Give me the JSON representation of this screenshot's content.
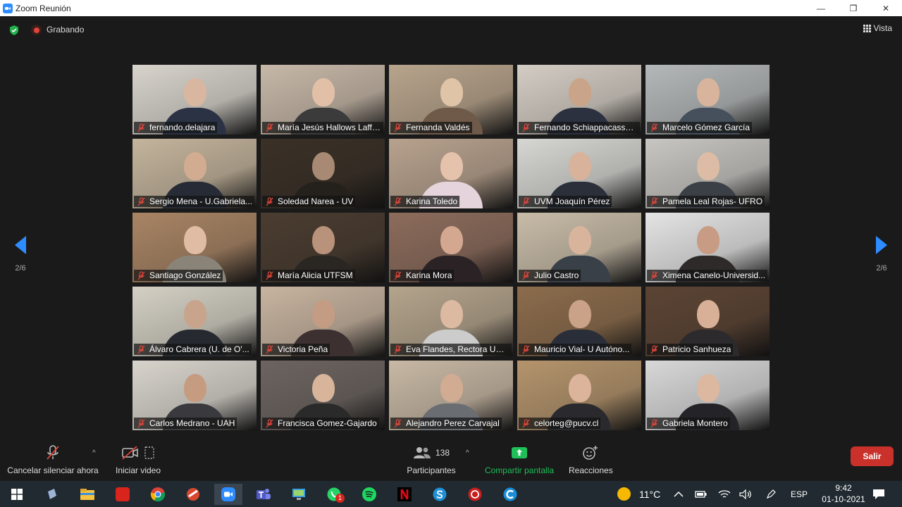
{
  "window": {
    "title": "Zoom Reunión",
    "minimize": "—",
    "maximize": "❐",
    "close": "✕"
  },
  "meeting": {
    "recording_label": "Grabando",
    "view_label": "Vista",
    "page_indicator": "2/6"
  },
  "participants": [
    {
      "name": "fernando.delajara",
      "bg": "#d8d4cc",
      "skin": "#d9b6a0",
      "shirt": "#2a3244"
    },
    {
      "name": "María Jesús Hallows Laffe...",
      "bg": "#c7b8a8",
      "skin": "#e2c0a8",
      "shirt": "#3b3b3b"
    },
    {
      "name": "Fernanda Valdés",
      "bg": "#b8a48c",
      "skin": "#e0c4a8",
      "shirt": "#6f5a4a"
    },
    {
      "name": "Fernando Schiappacasse ...",
      "bg": "#d4cdc4",
      "skin": "#c9a488",
      "shirt": "#2c3140"
    },
    {
      "name": "Marcelo Gómez García",
      "bg": "#b4b8b8",
      "skin": "#d8b49c",
      "shirt": "#46505c"
    },
    {
      "name": "Sergio Mena - U.Gabriela...",
      "bg": "#c4b49c",
      "skin": "#d2ac90",
      "shirt": "#262b36"
    },
    {
      "name": "Soledad Narea - UV",
      "bg": "#3a3026",
      "skin": "#a88a74",
      "shirt": "#24201c"
    },
    {
      "name": "Karina Toledo",
      "bg": "#b8a28e",
      "skin": "#e4c2ac",
      "shirt": "#e6d4dc"
    },
    {
      "name": "UVM Joaquín Pérez",
      "bg": "#d6d6d2",
      "skin": "#d8b29a",
      "shirt": "#2a2f3a"
    },
    {
      "name": "Pamela Leal Rojas- UFRO",
      "bg": "#c8c6c2",
      "skin": "#dcbca4",
      "shirt": "#3b3f46"
    },
    {
      "name": "Santiago González",
      "bg": "#a88464",
      "skin": "#e0bca4",
      "shirt": "#8a8478"
    },
    {
      "name": "María Alicia UTFSM",
      "bg": "#4a3c30",
      "skin": "#b8927a",
      "shirt": "#2a2622"
    },
    {
      "name": "Karina Mora",
      "bg": "#8c6c5c",
      "skin": "#d4a890",
      "shirt": "#2a2224"
    },
    {
      "name": "Julio Castro",
      "bg": "#c8bca8",
      "skin": "#d8b49c",
      "shirt": "#3a4048"
    },
    {
      "name": "Ximena Canelo-Universid...",
      "bg": "#e4e4e4",
      "skin": "#c89c84",
      "shirt": "#2e2a2a"
    },
    {
      "name": "Álvaro Cabrera (U. de O'...",
      "bg": "#d4d0c4",
      "skin": "#c8a48c",
      "shirt": "#262a30"
    },
    {
      "name": "Victoria Peña",
      "bg": "#c8b4a0",
      "skin": "#c49c84",
      "shirt": "#3c3030"
    },
    {
      "name": "Eva Flandes, Rectora USEK",
      "bg": "#b4a48c",
      "skin": "#dcbaa2",
      "shirt": "#cccccc"
    },
    {
      "name": "Mauricio Vial- U Autóno...",
      "bg": "#8c6c4c",
      "skin": "#caa288",
      "shirt": "#2a2e38"
    },
    {
      "name": "Patricio Sanhueza",
      "bg": "#5c4434",
      "skin": "#d8b098",
      "shirt": "#2c2a2c"
    },
    {
      "name": "Carlos Medrano - UAH",
      "bg": "#d8d4cc",
      "skin": "#c69c80",
      "shirt": "#3a3a3e"
    },
    {
      "name": "Francisca Gomez-Gajardo",
      "bg": "#6c6460",
      "skin": "#d8b49a",
      "shirt": "#2a2a2a"
    },
    {
      "name": "Alejandro Perez Carvajal",
      "bg": "#c8b8a4",
      "skin": "#d2ac92",
      "shirt": "#6a6e72"
    },
    {
      "name": "celorteg@pucv.cl",
      "bg": "#b4946c",
      "skin": "#dcb49c",
      "shirt": "#2a2a2e"
    },
    {
      "name": "Gabriela Montero",
      "bg": "#d8d8d8",
      "skin": "#dcb8a0",
      "shirt": "#242428"
    }
  ],
  "toolbar": {
    "unmute_label": "Cancelar silenciar ahora",
    "video_label": "Iniciar video",
    "participants_label": "Participantes",
    "participants_count": "138",
    "share_label": "Compartir pantalla",
    "reactions_label": "Reacciones",
    "leave_label": "Salir"
  },
  "colors": {
    "accent": "#2d8cff",
    "share_green": "#1fbf5a",
    "leave_red": "#c9312a",
    "muted_red": "#e0453a"
  },
  "taskbar": {
    "apps": [
      "start-icon",
      "search-icon",
      "file-explorer-icon",
      "acrobat-icon",
      "chrome-icon",
      "ccleaner-icon",
      "zoom-icon",
      "teams-icon",
      "remote-desktop-icon",
      "whatsapp-icon",
      "spotify-icon",
      "netflix-icon",
      "skype-icon",
      "antivirus-icon",
      "ccleaner-browser-icon"
    ],
    "whatsapp_badge": "1",
    "temperature": "11°C",
    "language": "ESP",
    "time": "9:42",
    "date": "01-10-2021"
  }
}
